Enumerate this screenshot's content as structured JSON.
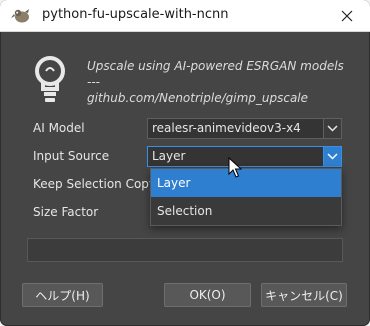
{
  "window": {
    "title": "python-fu-upscale-with-ncnn"
  },
  "description": {
    "line1": "Upscale using AI-powered ESRGAN models",
    "line2": "---",
    "line3": "github.com/Nenotriple/gimp_upscale"
  },
  "fields": {
    "ai_model": {
      "label": "AI Model",
      "value": "realesr-animevideov3-x4"
    },
    "input_source": {
      "label": "Input Source",
      "value": "Layer"
    },
    "keep_selection_copy": {
      "label": "Keep Selection Copy"
    },
    "size_factor": {
      "label": "Size Factor"
    }
  },
  "dropdown": {
    "options": [
      "Layer",
      "Selection"
    ],
    "selected": "Layer"
  },
  "progress": {
    "value": 0
  },
  "buttons": {
    "help": "ヘルプ(H)",
    "ok": "OK(O)",
    "cancel": "キャンセル(C)"
  },
  "colors": {
    "dialog_bg": "#454545",
    "accent": "#2f7fd1",
    "titlebar": "#ffffff"
  },
  "icons": [
    "gimp-app-icon",
    "close-icon",
    "lightbulb-icon",
    "chevron-down-icon",
    "mouse-pointer-icon"
  ]
}
